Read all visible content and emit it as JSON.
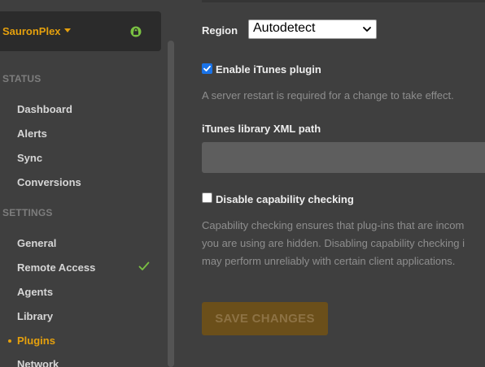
{
  "sidebar": {
    "server_name": "SauronPlex",
    "status_title": "STATUS",
    "status_items": [
      {
        "label": "Dashboard"
      },
      {
        "label": "Alerts"
      },
      {
        "label": "Sync"
      },
      {
        "label": "Conversions"
      }
    ],
    "settings_title": "SETTINGS",
    "settings_items": [
      {
        "label": "General"
      },
      {
        "label": "Remote Access"
      },
      {
        "label": "Agents"
      },
      {
        "label": "Library"
      },
      {
        "label": "Plugins"
      },
      {
        "label": "Network"
      }
    ],
    "active_item": "Plugins"
  },
  "main": {
    "region_label": "Region",
    "region_value": "Autodetect",
    "itunes_plugin": {
      "label": "Enable iTunes plugin",
      "checked": true,
      "help": "A server restart is required for a change to take effect."
    },
    "itunes_xml": {
      "label": "iTunes library XML path",
      "value": ""
    },
    "capability": {
      "label": "Disable capability checking",
      "checked": false,
      "help_lines": [
        "Capability checking ensures that plug-ins that are incom",
        "you are using are hidden. Disabling capability checking i",
        "may perform unreliably with certain client applications."
      ]
    },
    "save_label": "SAVE CHANGES"
  },
  "colors": {
    "accent": "#e5a00d",
    "background": "#3f3f3f",
    "success": "#7ac142"
  },
  "icons": {
    "server_status": "lock-icon",
    "remote_access_status": "check-icon",
    "server_menu": "caret-down-icon"
  }
}
